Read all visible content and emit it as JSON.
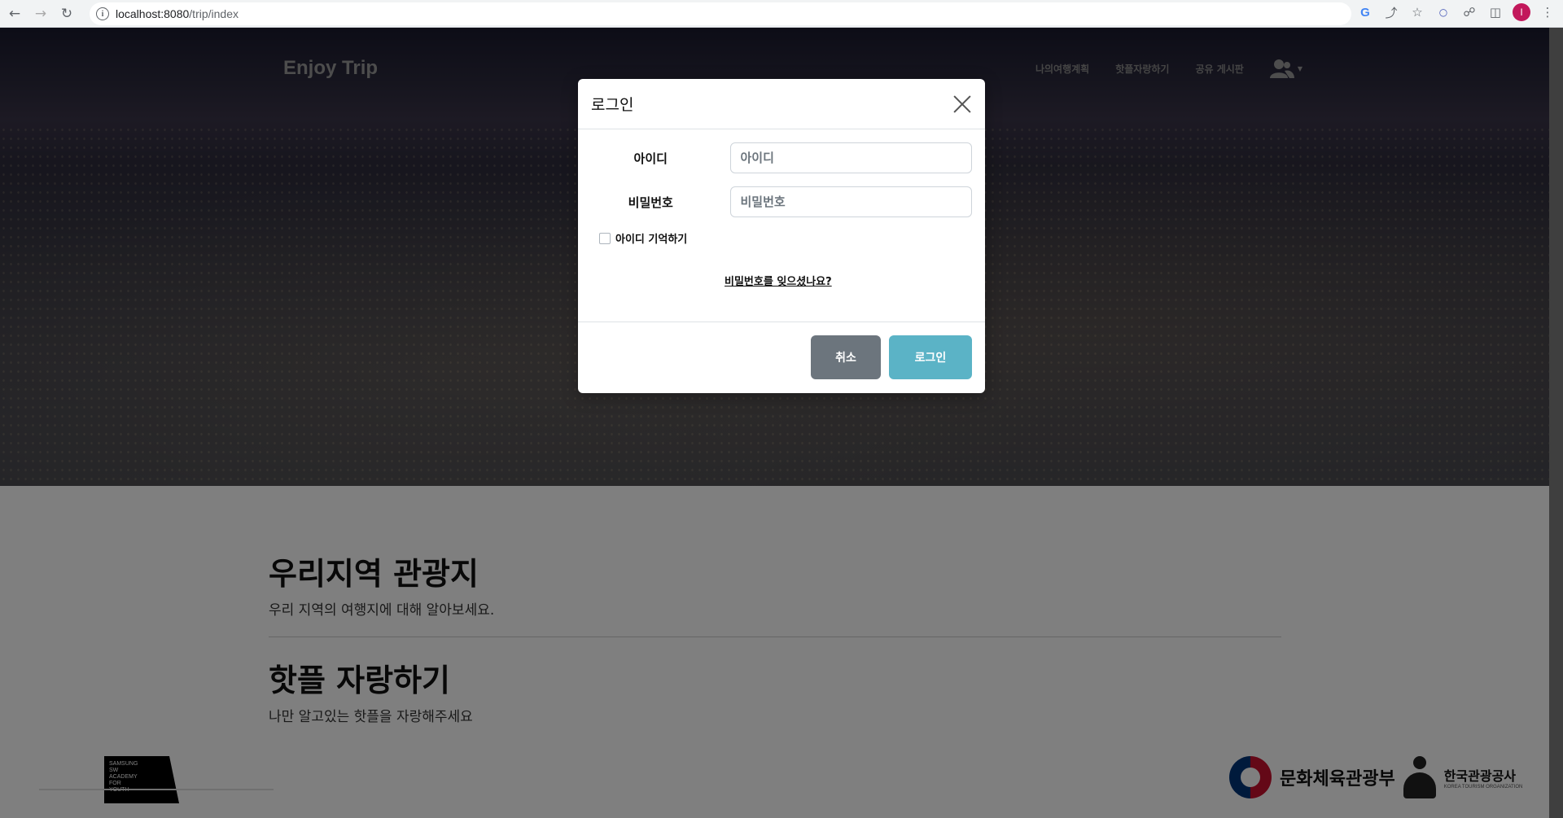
{
  "browser": {
    "url_host": "localhost:8080",
    "url_path": "/trip/index",
    "profile_initial": "I",
    "google_icon": "G"
  },
  "site": {
    "brand": "Enjoy Trip",
    "nav": [
      "나의여행계획",
      "핫플자랑하기",
      "공유 게시판"
    ],
    "user_icon": "user-icon"
  },
  "sections": [
    {
      "title": "우리지역 관광지",
      "subtitle": "우리 지역의 여행지에 대해 알아보세요."
    },
    {
      "title": "핫플 자랑하기",
      "subtitle": "나만 알고있는 핫플을 자랑해주세요"
    }
  ],
  "footer": {
    "ssafy_lines": [
      "SAMSUNG",
      "SW",
      "ACADEMY",
      "FOR",
      "YOUTH"
    ],
    "mcst": "문화체육관광부",
    "kto_main": "한국관광공사",
    "kto_sub": "KOREA TOURISM ORGANIZATION"
  },
  "modal": {
    "title": "로그인",
    "id_label": "아이디",
    "id_placeholder": "아이디",
    "pw_label": "비밀번호",
    "pw_placeholder": "비밀번호",
    "remember_label": "아이디 기억하기",
    "forgot_link": "비밀번호를 잊으셨나요?",
    "cancel_label": "취소",
    "login_label": "로그인"
  }
}
